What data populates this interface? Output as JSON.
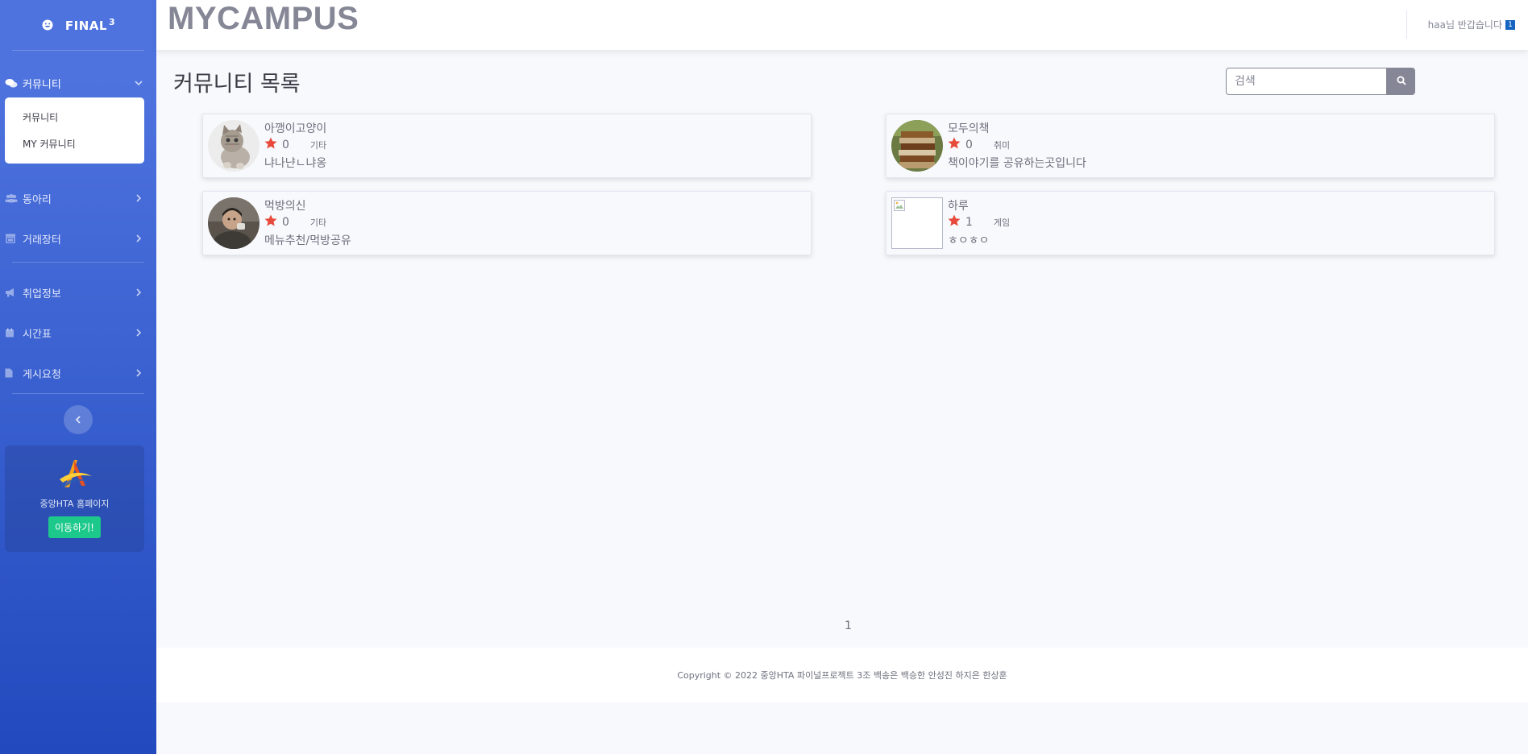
{
  "sidebar": {
    "brand": "FINAL",
    "brand_sup": "3",
    "community": {
      "label": "커뮤니티",
      "submenu": [
        "커뮤니티",
        "MY 커뮤니티"
      ]
    },
    "items": [
      {
        "label": "동아리",
        "icon": "users-icon"
      },
      {
        "label": "거래장터",
        "icon": "store-icon"
      },
      {
        "label": "취업정보",
        "icon": "bullhorn-icon"
      },
      {
        "label": "시간표",
        "icon": "calendar-icon"
      },
      {
        "label": "게시요청",
        "icon": "file-icon"
      }
    ],
    "promo": {
      "text": "중앙HTA 홈페이지",
      "button": "이동하기!"
    }
  },
  "topbar": {
    "title": "MYCAMPUS",
    "user_greeting": "haa님 반갑습니다",
    "user_badge": "1"
  },
  "main": {
    "page_title": "커뮤니티 목록",
    "search_placeholder": "검색",
    "communities": [
      {
        "name": "아깽이고양이",
        "likes": "0",
        "category": "기타",
        "description": "냐나냔ㄴ냐옹",
        "avatar": "kitten"
      },
      {
        "name": "모두의책",
        "likes": "0",
        "category": "취미",
        "description": "책이야기를 공유하는곳입니다",
        "avatar": "books"
      },
      {
        "name": "먹방의신",
        "likes": "0",
        "category": "기타",
        "description": "메뉴추천/먹방공유",
        "avatar": "person"
      },
      {
        "name": "하루",
        "likes": "1",
        "category": "게임",
        "description": "ㅎㅇㅎㅇ",
        "avatar": "broken"
      }
    ],
    "pagination": [
      "1"
    ]
  },
  "footer": {
    "copyright": "Copyright © 2022 중앙HTA 파이널프로젝트 3조 백송은 백승한 안성진 하지은 한상훈"
  },
  "colors": {
    "sidebar_top": "#4e73df",
    "sidebar_bottom": "#224abe",
    "star": "#e74a3b",
    "promo_button": "#1cc88a"
  }
}
